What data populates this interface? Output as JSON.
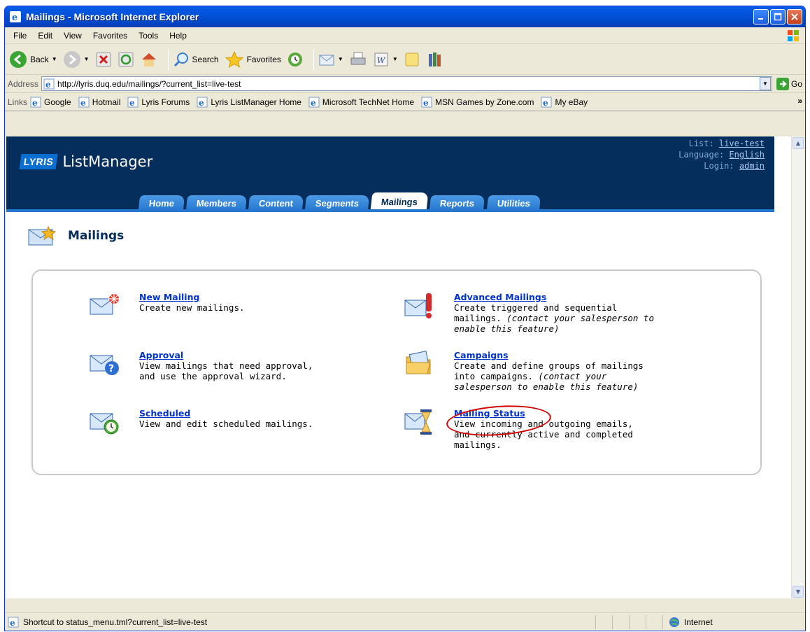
{
  "window": {
    "title": "Mailings - Microsoft Internet Explorer"
  },
  "menubar": {
    "items": [
      "File",
      "Edit",
      "View",
      "Favorites",
      "Tools",
      "Help"
    ]
  },
  "toolbar": {
    "back_label": "Back",
    "search_label": "Search",
    "favorites_label": "Favorites"
  },
  "addressbar": {
    "label": "Address",
    "url": "http://lyris.duq.edu/mailings/?current_list=live-test",
    "go_label": "Go"
  },
  "linksbar": {
    "label": "Links",
    "items": [
      "Google",
      "Hotmail",
      "Lyris Forums",
      "Lyris ListManager Home",
      "Microsoft TechNet Home",
      "MSN Games by Zone.com",
      "My eBay"
    ]
  },
  "lyris": {
    "badge": "LYRIS",
    "product": "ListManager",
    "list_label": "List:",
    "list_value": "live-test",
    "language_label": "Language:",
    "language_value": "English",
    "login_label": "Login:",
    "login_value": "admin"
  },
  "tabs": [
    "Home",
    "Members",
    "Content",
    "Segments",
    "Mailings",
    "Reports",
    "Utilities"
  ],
  "active_tab": "Mailings",
  "page": {
    "heading": "Mailings"
  },
  "options": {
    "new_mailing": {
      "title": "New Mailing",
      "desc": "Create new mailings."
    },
    "approval": {
      "title": "Approval",
      "desc1": "View mailings that need approval,",
      "desc2": "and use the approval wizard."
    },
    "scheduled": {
      "title": "Scheduled",
      "desc": "View and edit scheduled mailings."
    },
    "advanced": {
      "title": "Advanced Mailings",
      "desc1": "Create triggered and sequential",
      "desc2": "mailings.",
      "note1": "(contact your salesperson to",
      "note2": "enable this feature)"
    },
    "campaigns": {
      "title": "Campaigns",
      "desc1": "Create and define groups of mailings",
      "desc2": "into campaigns.",
      "note1": "(contact your",
      "note2": "salesperson to enable this feature)"
    },
    "status": {
      "title": "Mailing Status",
      "desc1": "View incoming and outgoing emails,",
      "desc2": "and currently active and completed",
      "desc3": "mailings."
    }
  },
  "statusbar": {
    "text": "Shortcut to status_menu.tml?current_list=live-test",
    "zone": "Internet"
  }
}
